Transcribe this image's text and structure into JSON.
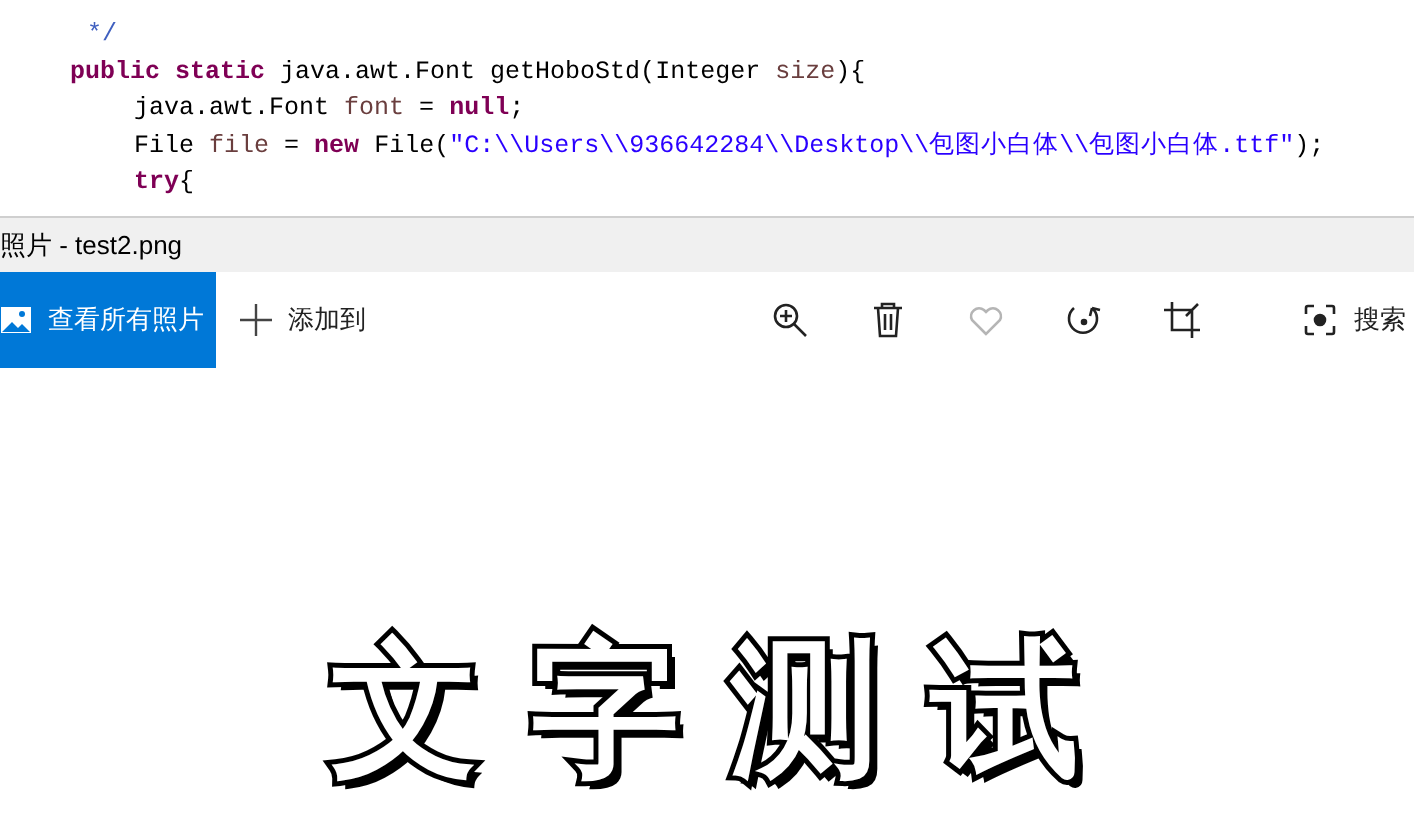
{
  "code_lines": [
    {
      "kind": "comment",
      "tokens": [
        {
          "kind": "comment",
          "text": " */"
        }
      ]
    },
    {
      "kind": "member",
      "tokens": [
        {
          "kind": "keyword",
          "text": "public static"
        },
        {
          "kind": "plain",
          "text": " java.awt.Font getHoboStd(Integer "
        },
        {
          "kind": "variable",
          "text": "size"
        },
        {
          "kind": "plain",
          "text": "){"
        }
      ]
    },
    {
      "kind": "body",
      "tokens": [
        {
          "kind": "plain",
          "text": "java.awt.Font "
        },
        {
          "kind": "variable",
          "text": "font"
        },
        {
          "kind": "plain",
          "text": " = "
        },
        {
          "kind": "keyword",
          "text": "null"
        },
        {
          "kind": "plain",
          "text": ";"
        }
      ]
    },
    {
      "kind": "body",
      "tokens": [
        {
          "kind": "plain",
          "text": "File "
        },
        {
          "kind": "variable",
          "text": "file"
        },
        {
          "kind": "plain",
          "text": " = "
        },
        {
          "kind": "keyword",
          "text": "new"
        },
        {
          "kind": "plain",
          "text": " File("
        },
        {
          "kind": "string",
          "text": "\"C:\\\\Users\\\\936642284\\\\Desktop\\\\包图小白体\\\\包图小白体.ttf\""
        },
        {
          "kind": "plain",
          "text": ");"
        }
      ]
    },
    {
      "kind": "body",
      "tokens": [
        {
          "kind": "keyword",
          "text": "try"
        },
        {
          "kind": "plain",
          "text": "{"
        }
      ]
    }
  ],
  "window": {
    "title": "照片 - test2.png"
  },
  "toolbar": {
    "view_all": "查看所有照片",
    "add_to": "添加到",
    "actions": [
      {
        "kind": "zoom",
        "disabled": false
      },
      {
        "kind": "delete",
        "disabled": false
      },
      {
        "kind": "favorite",
        "disabled": true
      },
      {
        "kind": "rotate",
        "disabled": false
      },
      {
        "kind": "crop",
        "disabled": false
      }
    ],
    "search": "搜索"
  },
  "image_text": "文字测试"
}
